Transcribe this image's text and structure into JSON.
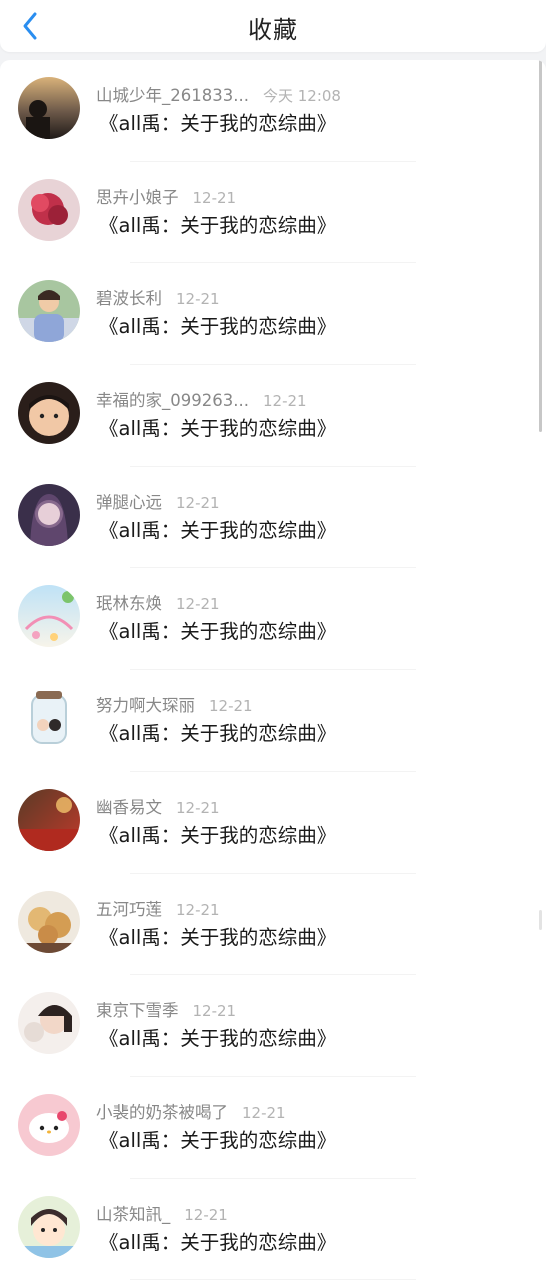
{
  "header": {
    "title": "收藏",
    "back_icon": "chevron-left-icon",
    "accent_color": "#2a8ef0"
  },
  "items": [
    {
      "name": "山城少年_261833...",
      "time": "今天 12:08",
      "message": "《all禹：关于我的恋综曲》"
    },
    {
      "name": "思卉小娘子",
      "time": "12-21",
      "message": "《all禹：关于我的恋综曲》"
    },
    {
      "name": "碧波长利",
      "time": "12-21",
      "message": "《all禹：关于我的恋综曲》"
    },
    {
      "name": "幸福的家_099263...",
      "time": "12-21",
      "message": "《all禹：关于我的恋综曲》"
    },
    {
      "name": "弹腿心远",
      "time": "12-21",
      "message": "《all禹：关于我的恋综曲》"
    },
    {
      "name": "珉林东焕",
      "time": "12-21",
      "message": "《all禹：关于我的恋综曲》"
    },
    {
      "name": "努力啊大琛丽",
      "time": "12-21",
      "message": "《all禹：关于我的恋综曲》"
    },
    {
      "name": "幽香易文",
      "time": "12-21",
      "message": "《all禹：关于我的恋综曲》"
    },
    {
      "name": "五河巧莲",
      "time": "12-21",
      "message": "《all禹：关于我的恋综曲》"
    },
    {
      "name": "東京下雪季",
      "time": "12-21",
      "message": "《all禹：关于我的恋综曲》"
    },
    {
      "name": "小裴的奶茶被喝了",
      "time": "12-21",
      "message": "《all禹：关于我的恋综曲》"
    },
    {
      "name": "山茶知訊_",
      "time": "12-21",
      "message": "《all禹：关于我的恋综曲》"
    }
  ]
}
